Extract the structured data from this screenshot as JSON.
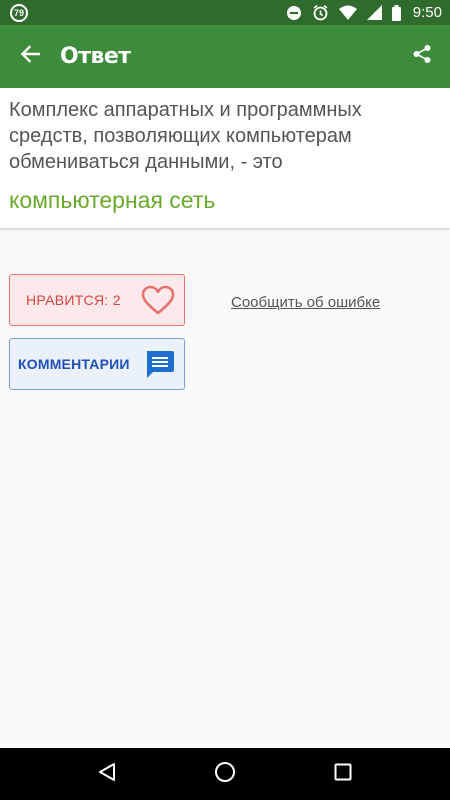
{
  "status_bar": {
    "notification_count": "79",
    "time": "9:50",
    "icons": [
      "dnd-icon",
      "alarm-icon",
      "wifi-icon",
      "signal-icon",
      "battery-icon"
    ]
  },
  "app_bar": {
    "title": "Ответ",
    "back_icon": "arrow-back-icon",
    "share_icon": "share-icon"
  },
  "question": {
    "text": "Комплекс аппаратных и программных средств, позволяющих компьютерам обмениваться данными, - это",
    "answer": "компьютерная сеть"
  },
  "actions": {
    "like_label": "НРАВИТСЯ: 2",
    "comments_label": "КОММЕНТАРИИ",
    "report_label": "Сообщить об ошибке"
  },
  "nav_bar": {
    "buttons": [
      "back-triangle-icon",
      "home-circle-icon",
      "recents-square-icon"
    ]
  },
  "colors": {
    "status_bar": "#2e6b2c",
    "app_bar": "#3d8c3b",
    "answer": "#6aa92b",
    "like_border": "#e57373",
    "comments_blue": "#1f50b8"
  }
}
